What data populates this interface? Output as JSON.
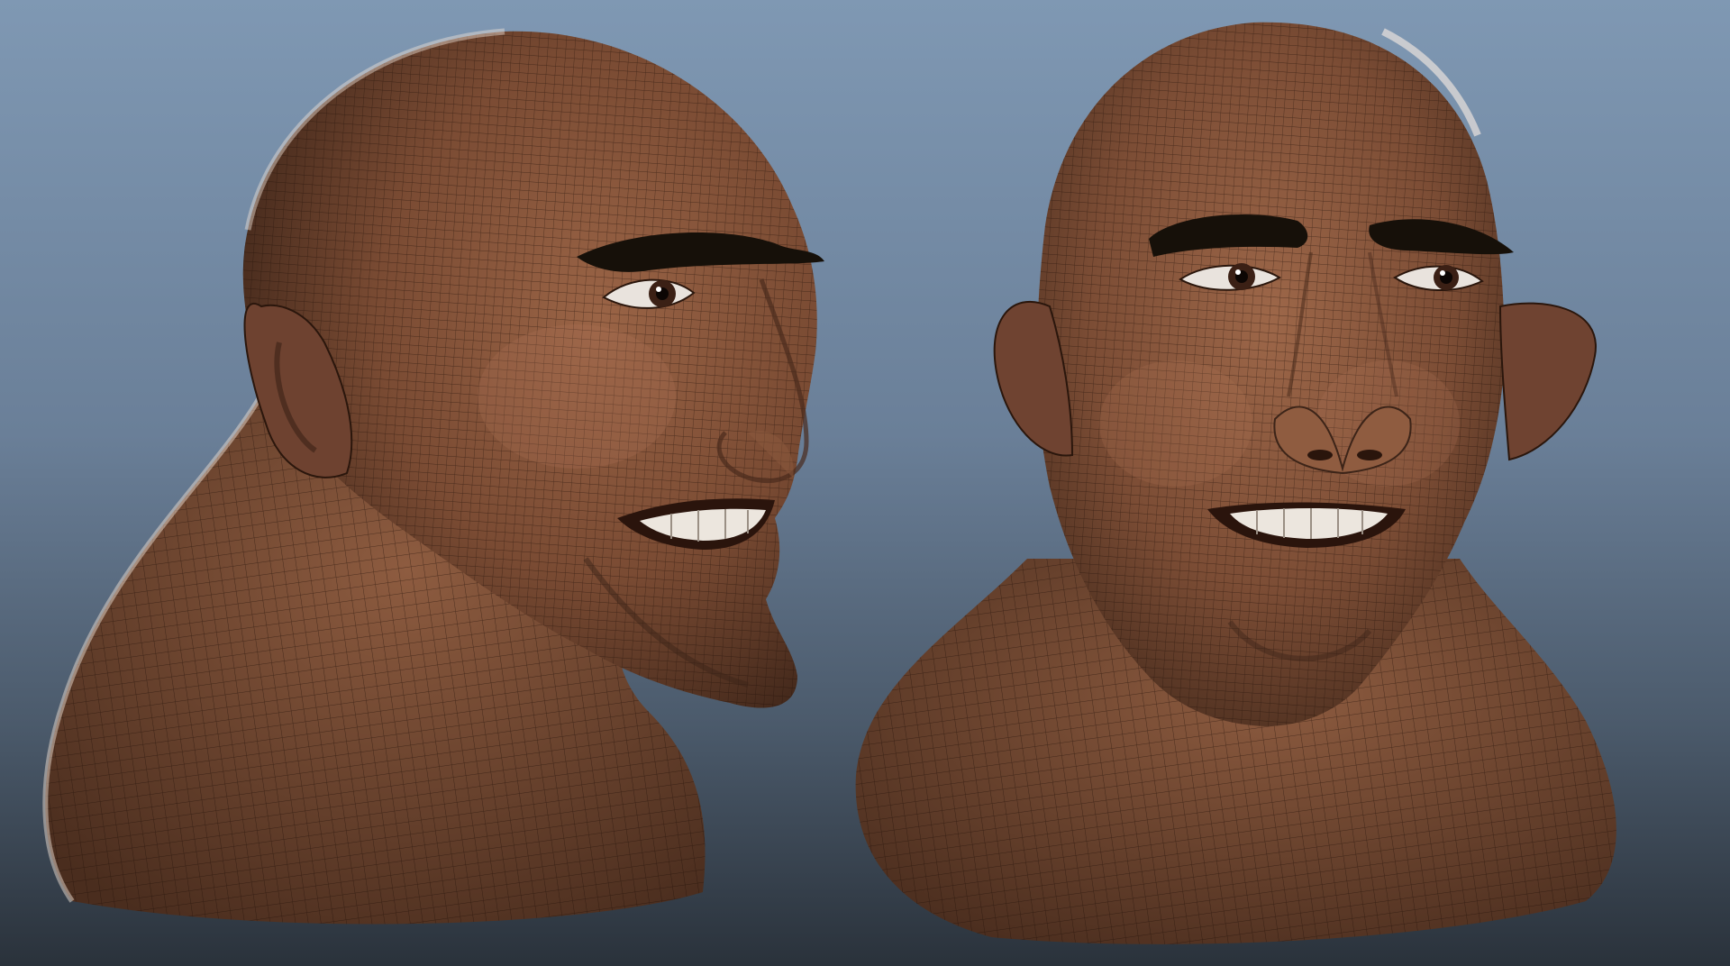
{
  "viewport": {
    "background_top": "#7f98b3",
    "background_bottom": "#2a323b"
  },
  "models": [
    {
      "label": "head-model-three-quarter-view",
      "view": "three-quarter",
      "skin": "#7a4b33",
      "wire": "#2a160c"
    },
    {
      "label": "head-model-front-view",
      "view": "front",
      "skin": "#7c4d35",
      "wire": "#2a160c"
    }
  ]
}
